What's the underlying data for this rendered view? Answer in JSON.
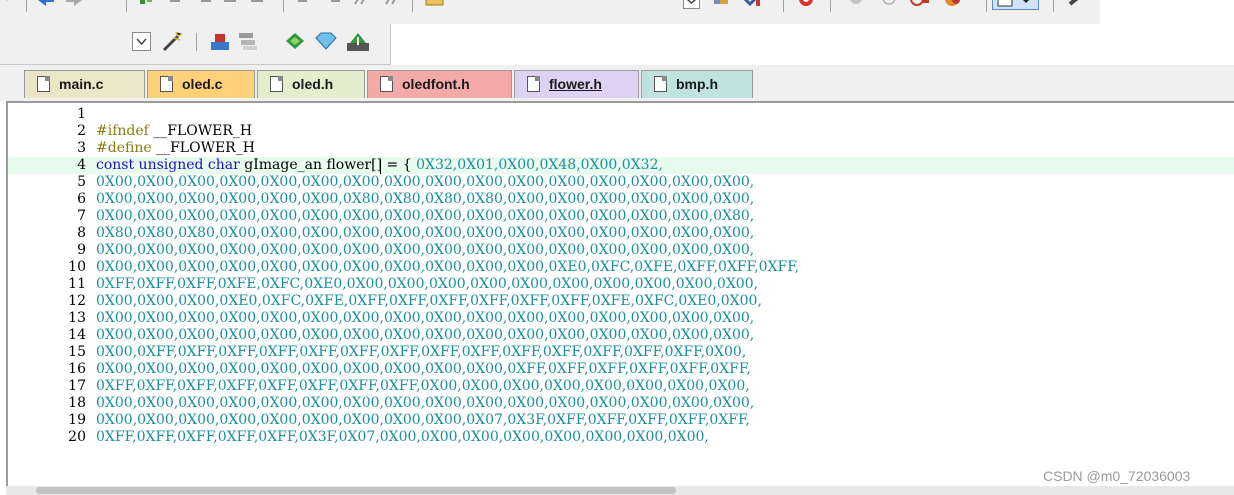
{
  "toolbar_top": {
    "icons": [
      "undo-icon",
      "back-arrow-icon",
      "forward-arrow-icon",
      "bookmark-icon",
      "indent-icon",
      "outdent-icon",
      "comment-icon",
      "uncomment-icon",
      "align-left-icon",
      "align-right-icon",
      "format-icon",
      "format-clear-icon",
      "open-file-icon",
      "dropdown-icon",
      "batch-icon",
      "download-icon",
      "debug-icon",
      "stop-icon",
      "breakpoint-icon",
      "run-to-cursor-icon",
      "settings-icon",
      "window-icon",
      "wrench-icon"
    ]
  },
  "toolbar_second": {
    "icons": [
      "dropdown-icon",
      "magic-wand-icon",
      "build-icon",
      "layers-icon",
      "diamond-icon",
      "gem-icon",
      "download-target-icon"
    ]
  },
  "tabs": [
    {
      "label": "main.c",
      "color": "#ebe6c8",
      "active": false
    },
    {
      "label": "oled.c",
      "color": "#ffd27a",
      "active": false
    },
    {
      "label": "oled.h",
      "color": "#e4eecf",
      "active": false
    },
    {
      "label": "oledfont.h",
      "color": "#f6a9a9",
      "active": false
    },
    {
      "label": "flower.h",
      "color": "#ddd2f2",
      "active": true
    },
    {
      "label": "bmp.h",
      "color": "#bfe3df",
      "active": false
    }
  ],
  "editor": {
    "lines": [
      {
        "n": "1",
        "parts": []
      },
      {
        "n": "2",
        "parts": [
          {
            "c": "pp",
            "t": "#ifndef"
          },
          {
            "c": "tx",
            "t": " __FLOWER_H"
          }
        ]
      },
      {
        "n": "3",
        "parts": [
          {
            "c": "pp",
            "t": "#define"
          },
          {
            "c": "tx",
            "t": " __FLOWER_H"
          }
        ]
      },
      {
        "n": "4",
        "current": true,
        "parts": [
          {
            "c": "kw",
            "t": "const unsigned char"
          },
          {
            "c": "tx",
            "t": " gImage_an flower[] = { "
          },
          {
            "c": "",
            "t": "0X32,0X01,0X00,0X48,0X00,0X32,"
          }
        ]
      },
      {
        "n": "5",
        "parts": [
          {
            "c": "",
            "t": "0X00,0X00,0X00,0X00,0X00,0X00,0X00,0X00,0X00,0X00,0X00,0X00,0X00,0X00,0X00,0X00,"
          }
        ]
      },
      {
        "n": "6",
        "parts": [
          {
            "c": "",
            "t": "0X00,0X00,0X00,0X00,0X00,0X00,0X80,0X80,0X80,0X80,0X00,0X00,0X00,0X00,0X00,0X00,"
          }
        ]
      },
      {
        "n": "7",
        "parts": [
          {
            "c": "",
            "t": "0X00,0X00,0X00,0X00,0X00,0X00,0X00,0X00,0X00,0X00,0X00,0X00,0X00,0X00,0X00,0X80,"
          }
        ]
      },
      {
        "n": "8",
        "parts": [
          {
            "c": "",
            "t": "0X80,0X80,0X80,0X00,0X00,0X00,0X00,0X00,0X00,0X00,0X00,0X00,0X00,0X00,0X00,0X00,"
          }
        ]
      },
      {
        "n": "9",
        "parts": [
          {
            "c": "",
            "t": "0X00,0X00,0X00,0X00,0X00,0X00,0X00,0X00,0X00,0X00,0X00,0X00,0X00,0X00,0X00,0X00,"
          }
        ]
      },
      {
        "n": "10",
        "parts": [
          {
            "c": "",
            "t": "0X00,0X00,0X00,0X00,0X00,0X00,0X00,0X00,0X00,0X00,0X00,0XE0,0XFC,0XFE,0XFF,0XFF,0XFF,"
          }
        ]
      },
      {
        "n": "11",
        "parts": [
          {
            "c": "",
            "t": "0XFF,0XFF,0XFF,0XFE,0XFC,0XE0,0X00,0X00,0X00,0X00,0X00,0X00,0X00,0X00,0X00,0X00,"
          }
        ]
      },
      {
        "n": "12",
        "parts": [
          {
            "c": "",
            "t": "0X00,0X00,0X00,0XE0,0XFC,0XFE,0XFF,0XFF,0XFF,0XFF,0XFF,0XFF,0XFE,0XFC,0XE0,0X00,"
          }
        ]
      },
      {
        "n": "13",
        "parts": [
          {
            "c": "",
            "t": "0X00,0X00,0X00,0X00,0X00,0X00,0X00,0X00,0X00,0X00,0X00,0X00,0X00,0X00,0X00,0X00,"
          }
        ]
      },
      {
        "n": "14",
        "parts": [
          {
            "c": "",
            "t": "0X00,0X00,0X00,0X00,0X00,0X00,0X00,0X00,0X00,0X00,0X00,0X00,0X00,0X00,0X00,0X00,"
          }
        ]
      },
      {
        "n": "15",
        "parts": [
          {
            "c": "",
            "t": "0X00,0XFF,0XFF,0XFF,0XFF,0XFF,0XFF,0XFF,0XFF,0XFF,0XFF,0XFF,0XFF,0XFF,0XFF,0X00,"
          }
        ]
      },
      {
        "n": "16",
        "parts": [
          {
            "c": "",
            "t": "0X00,0X00,0X00,0X00,0X00,0X00,0X00,0X00,0X00,0X00,0XFF,0XFF,0XFF,0XFF,0XFF,0XFF,"
          }
        ]
      },
      {
        "n": "17",
        "parts": [
          {
            "c": "",
            "t": "0XFF,0XFF,0XFF,0XFF,0XFF,0XFF,0XFF,0XFF,0X00,0X00,0X00,0X00,0X00,0X00,0X00,0X00,"
          }
        ]
      },
      {
        "n": "18",
        "parts": [
          {
            "c": "",
            "t": "0X00,0X00,0X00,0X00,0X00,0X00,0X00,0X00,0X00,0X00,0X00,0X00,0X00,0X00,0X00,0X00,"
          }
        ]
      },
      {
        "n": "19",
        "parts": [
          {
            "c": "",
            "t": "0X00,0X00,0X00,0X00,0X00,0X00,0X00,0X00,0X00,0X07,0X3F,0XFF,0XFF,0XFF,0XFF,0XFF,"
          }
        ]
      },
      {
        "n": "20",
        "parts": [
          {
            "c": "",
            "t": "0XFF,0XFF,0XFF,0XFF,0XFF,0X3F,0X07,0X00,0X00,0X00,0X00,0X00,0X00,0X00,0X00,"
          }
        ]
      }
    ]
  },
  "watermark": "CSDN @m0_72036003"
}
